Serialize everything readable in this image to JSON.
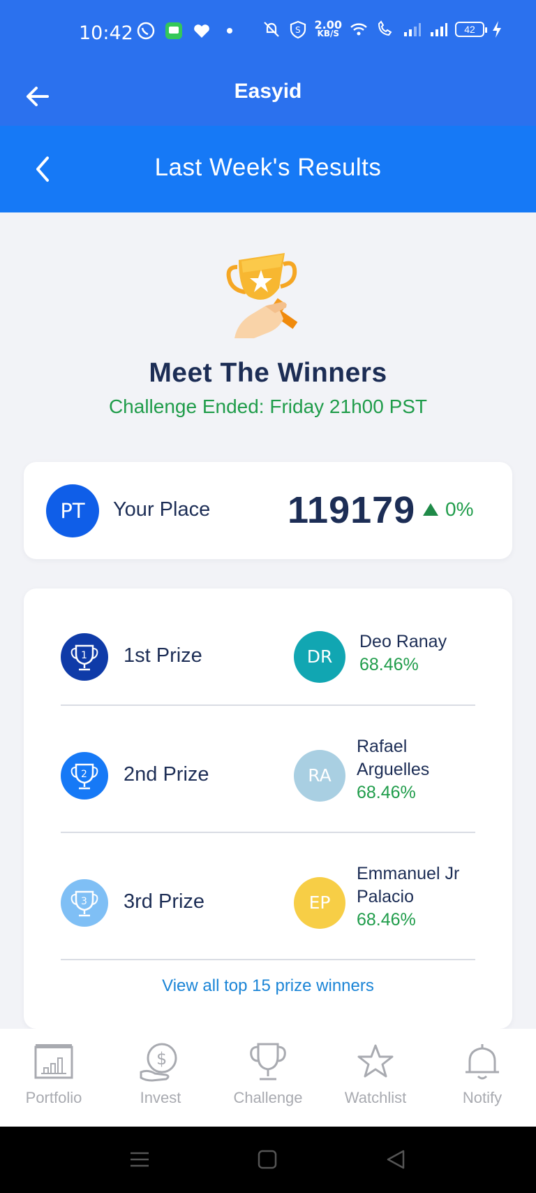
{
  "status_bar": {
    "time": "10:42",
    "speed_value": "2.00",
    "speed_unit": "KB/S",
    "battery": "42"
  },
  "app_bar": {
    "title": "Easyid"
  },
  "sub_header": {
    "title": "Last Week's Results"
  },
  "hero": {
    "title": "Meet The Winners",
    "subtitle": "Challenge Ended: Friday 21h00 PST"
  },
  "your_place": {
    "initials": "PT",
    "label": "Your Place",
    "rank": "119179",
    "change": "0%"
  },
  "prizes": [
    {
      "label": "1st Prize",
      "badge_number": "1",
      "winner_initials": "DR",
      "winner_name": "Deo Ranay",
      "winner_pct": "68.46%"
    },
    {
      "label": "2nd Prize",
      "badge_number": "2",
      "winner_initials": "RA",
      "winner_name": "Rafael Arguelles",
      "winner_pct": "68.46%"
    },
    {
      "label": "3rd Prize",
      "badge_number": "3",
      "winner_initials": "EP",
      "winner_name": "Emmanuel Jr Palacio",
      "winner_pct": "68.46%"
    }
  ],
  "view_all_link": "View all top 15 prize winners",
  "bottom_nav": [
    {
      "label": "Portfolio",
      "icon": "portfolio-icon"
    },
    {
      "label": "Invest",
      "icon": "invest-icon"
    },
    {
      "label": "Challenge",
      "icon": "challenge-icon"
    },
    {
      "label": "Watchlist",
      "icon": "watchlist-icon"
    },
    {
      "label": "Notify",
      "icon": "notify-icon"
    }
  ],
  "colors": {
    "primary": "#2b71ee",
    "sub_header": "#1679f6",
    "positive": "#1f9c4a",
    "first_prize": "#0f3ba8",
    "second_prize": "#1679f6",
    "third_prize": "#7fbff5",
    "avatar_dr": "#11a6b2",
    "avatar_ra": "#a9cfe2",
    "avatar_ep": "#f7ce46"
  }
}
